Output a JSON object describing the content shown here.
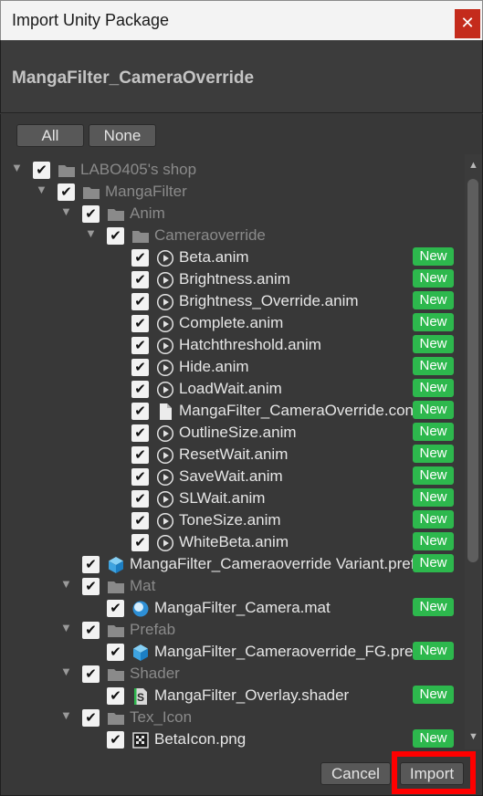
{
  "window": {
    "title": "Import Unity Package",
    "close_glyph": "✕"
  },
  "package": {
    "name": "MangaFilter_CameraOverride"
  },
  "toolbar": {
    "all_label": "All",
    "none_label": "None"
  },
  "new_badge": "New",
  "tree": [
    {
      "label": "LABO405's shop",
      "kind": "folder",
      "icon": "folder-icon",
      "depth": 0,
      "expanded": true,
      "checked": true,
      "new": false
    },
    {
      "label": "MangaFilter",
      "kind": "folder",
      "icon": "folder-icon",
      "depth": 1,
      "expanded": true,
      "checked": true,
      "new": false
    },
    {
      "label": "Anim",
      "kind": "folder",
      "icon": "folder-icon",
      "depth": 2,
      "expanded": true,
      "checked": true,
      "new": false
    },
    {
      "label": "Cameraoverride",
      "kind": "folder",
      "icon": "folder-icon",
      "depth": 3,
      "expanded": true,
      "checked": true,
      "new": false
    },
    {
      "label": "Beta.anim",
      "kind": "file",
      "icon": "animation-clip-icon",
      "depth": 4,
      "checked": true,
      "new": true
    },
    {
      "label": "Brightness.anim",
      "kind": "file",
      "icon": "animation-clip-icon",
      "depth": 4,
      "checked": true,
      "new": true
    },
    {
      "label": "Brightness_Override.anim",
      "kind": "file",
      "icon": "animation-clip-icon",
      "depth": 4,
      "checked": true,
      "new": true
    },
    {
      "label": "Complete.anim",
      "kind": "file",
      "icon": "animation-clip-icon",
      "depth": 4,
      "checked": true,
      "new": true
    },
    {
      "label": "Hatchthreshold.anim",
      "kind": "file",
      "icon": "animation-clip-icon",
      "depth": 4,
      "checked": true,
      "new": true
    },
    {
      "label": "Hide.anim",
      "kind": "file",
      "icon": "animation-clip-icon",
      "depth": 4,
      "checked": true,
      "new": true
    },
    {
      "label": "LoadWait.anim",
      "kind": "file",
      "icon": "animation-clip-icon",
      "depth": 4,
      "checked": true,
      "new": true
    },
    {
      "label": "MangaFilter_CameraOverride.contro",
      "kind": "file",
      "icon": "document-icon",
      "depth": 4,
      "checked": true,
      "new": true
    },
    {
      "label": "OutlineSize.anim",
      "kind": "file",
      "icon": "animation-clip-icon",
      "depth": 4,
      "checked": true,
      "new": true
    },
    {
      "label": "ResetWait.anim",
      "kind": "file",
      "icon": "animation-clip-icon",
      "depth": 4,
      "checked": true,
      "new": true
    },
    {
      "label": "SaveWait.anim",
      "kind": "file",
      "icon": "animation-clip-icon",
      "depth": 4,
      "checked": true,
      "new": true
    },
    {
      "label": "SLWait.anim",
      "kind": "file",
      "icon": "animation-clip-icon",
      "depth": 4,
      "checked": true,
      "new": true
    },
    {
      "label": "ToneSize.anim",
      "kind": "file",
      "icon": "animation-clip-icon",
      "depth": 4,
      "checked": true,
      "new": true
    },
    {
      "label": "WhiteBeta.anim",
      "kind": "file",
      "icon": "animation-clip-icon",
      "depth": 4,
      "checked": true,
      "new": true
    },
    {
      "label": "MangaFilter_Cameraoverride Variant.prefab",
      "kind": "file",
      "icon": "prefab-cube-icon",
      "depth": 2,
      "checked": true,
      "new": true
    },
    {
      "label": "Mat",
      "kind": "folder",
      "icon": "folder-icon",
      "depth": 2,
      "expanded": true,
      "checked": true,
      "new": false
    },
    {
      "label": "MangaFilter_Camera.mat",
      "kind": "file",
      "icon": "material-sphere-icon",
      "depth": 3,
      "checked": true,
      "new": true
    },
    {
      "label": "Prefab",
      "kind": "folder",
      "icon": "folder-icon",
      "depth": 2,
      "expanded": true,
      "checked": true,
      "new": false
    },
    {
      "label": "MangaFilter_Cameraoverride_FG.prefab",
      "kind": "file",
      "icon": "prefab-cube-icon",
      "depth": 3,
      "checked": true,
      "new": true
    },
    {
      "label": "Shader",
      "kind": "folder",
      "icon": "folder-icon",
      "depth": 2,
      "expanded": true,
      "checked": true,
      "new": false
    },
    {
      "label": "MangaFilter_Overlay.shader",
      "kind": "file",
      "icon": "shader-icon",
      "depth": 3,
      "checked": true,
      "new": true
    },
    {
      "label": "Tex_Icon",
      "kind": "folder",
      "icon": "folder-icon",
      "depth": 2,
      "expanded": true,
      "checked": true,
      "new": false
    },
    {
      "label": "BetaIcon.png",
      "kind": "file",
      "icon": "texture-icon",
      "depth": 3,
      "checked": true,
      "new": true
    }
  ],
  "footer": {
    "cancel_label": "Cancel",
    "import_label": "Import"
  },
  "colors": {
    "new_badge": "#2db84d",
    "highlight": "#ff0000",
    "close_button": "#c42b1c",
    "background": "#383838"
  }
}
